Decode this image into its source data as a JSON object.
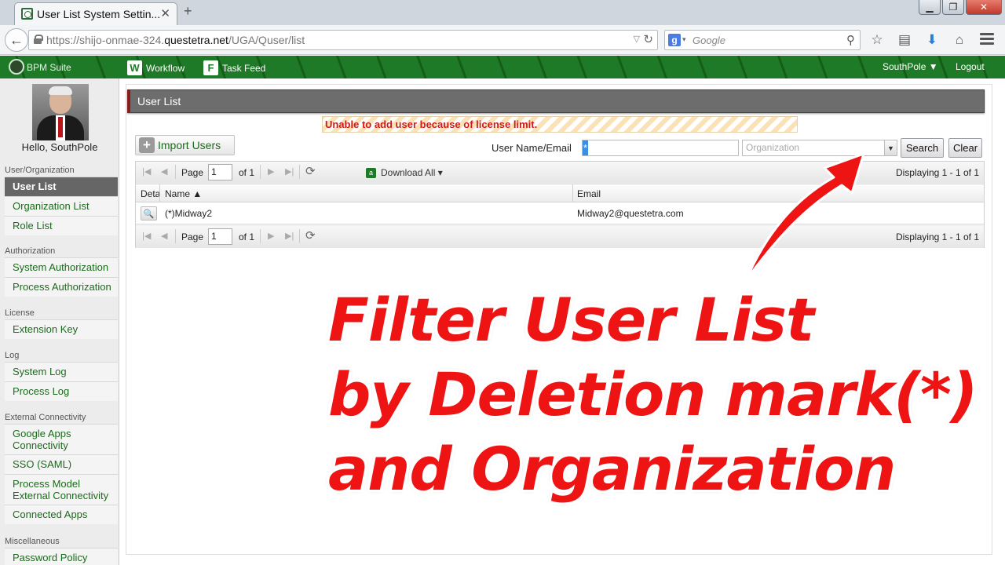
{
  "browser": {
    "tab_title": "User List System Settin...",
    "url_host": "https://shijo-onmae-324.",
    "url_domain": "questetra.net",
    "url_path": "/UGA/Quser/list",
    "search_placeholder": "Google",
    "search_engine_icon": "g"
  },
  "header": {
    "logo_text": "BPM Suite",
    "workflow_label": "Workflow",
    "workflow_icon": "W",
    "taskfeed_label": "Task Feed",
    "taskfeed_icon": "F",
    "user_menu_label": "SouthPole ▼",
    "logout_label": "Logout"
  },
  "sidebar": {
    "greeting": "Hello, SouthPole",
    "sections": [
      {
        "title": "User/Organization",
        "items": [
          "User List",
          "Organization List",
          "Role List"
        ]
      },
      {
        "title": "Authorization",
        "items": [
          "System Authorization",
          "Process Authorization"
        ]
      },
      {
        "title": "License",
        "items": [
          "Extension Key"
        ]
      },
      {
        "title": "Log",
        "items": [
          "System Log",
          "Process Log"
        ]
      },
      {
        "title": "External Connectivity",
        "items": [
          "Google Apps Connectivity",
          "SSO (SAML)",
          "Process Model External Connectivity",
          "Connected Apps"
        ]
      },
      {
        "title": "Miscellaneous",
        "items": [
          "Password Policy"
        ]
      }
    ],
    "active_item": "User List"
  },
  "main": {
    "title": "User List",
    "warning": "Unable to add user because of license limit.",
    "import_label": "Import Users",
    "search_label": "User Name/Email",
    "name_value": "*",
    "org_placeholder": "Organization",
    "search_button": "Search",
    "clear_button": "Clear"
  },
  "grid": {
    "page_label": "Page",
    "page_value": "1",
    "of_label": "of 1",
    "download_label": "Download All ▾",
    "displaying": "Displaying 1 - 1 of 1",
    "columns": [
      "Detail",
      "Name ▲",
      "Email"
    ],
    "rows": [
      {
        "name": "(*)Midway2",
        "email": "Midway2@questetra.com"
      }
    ]
  },
  "overlay": {
    "line1": "Filter User List",
    "line2": "by Deletion mark(*)",
    "line3": "and Organization",
    "color": "#ef1414"
  },
  "colors": {
    "header_green": "#1f7a27",
    "link_green": "#1a6b1a",
    "warning_red": "#d11a1a"
  }
}
